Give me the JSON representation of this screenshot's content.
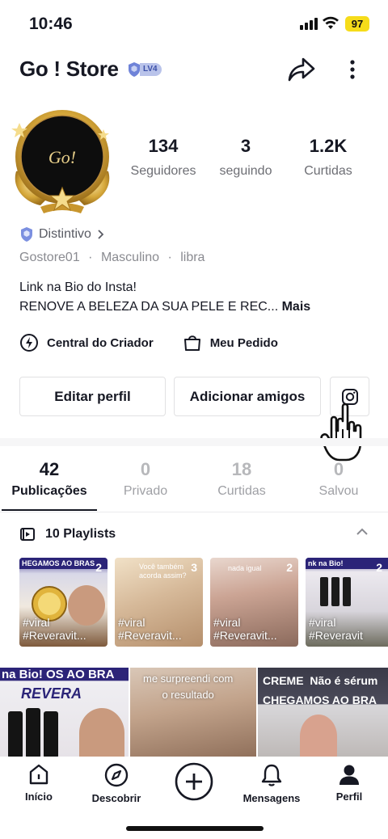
{
  "status_bar": {
    "time": "10:46",
    "battery": "97"
  },
  "header": {
    "title": "Go ! Store",
    "level": "LV4"
  },
  "profile": {
    "avatar_text": "Go!",
    "stats": [
      {
        "value": "134",
        "label": "Seguidores"
      },
      {
        "value": "3",
        "label": "seguindo"
      },
      {
        "value": "1.2K",
        "label": "Curtidas"
      }
    ],
    "badge_label": "Distintivo",
    "username": "Gostore01",
    "gender": "Masculino",
    "zodiac": "libra",
    "bio_line1": "Link na Bio do Insta!",
    "bio_line2": "RENOVE A BELEZA DA SUA PELE E REC...",
    "bio_more": "Mais"
  },
  "quick_links": {
    "creator_center": "Central do Criador",
    "my_order": "Meu Pedido"
  },
  "buttons": {
    "edit_profile": "Editar perfil",
    "add_friends": "Adicionar amigos"
  },
  "tabs": [
    {
      "count": "42",
      "label": "Publicações",
      "active": true
    },
    {
      "count": "0",
      "label": "Privado"
    },
    {
      "count": "18",
      "label": "Curtidas"
    },
    {
      "count": "0",
      "label": "Salvou"
    }
  ],
  "playlists": {
    "title": "10 Playlists",
    "items": [
      {
        "count": "2",
        "top_text": "HEGAMOS AO BRAS",
        "caption": "#viral\n#Reveravit..."
      },
      {
        "count": "3",
        "top_text": "Você também acorda assim?",
        "caption": "#viral\n#Reveravit..."
      },
      {
        "count": "2",
        "top_text": "nada igual",
        "caption": "#viral\n#Reveravit..."
      },
      {
        "count": "2",
        "top_text": "nk na Bio!",
        "caption": "#viral\n#Reveravit"
      }
    ]
  },
  "grid": [
    {
      "top_text": "na Bio!  OS AO BRA",
      "brand": "REVERA"
    },
    {
      "top_text": "me surpreendi com\no resultado"
    },
    {
      "top_text": "CREME  Não é sérum\nCHEGAMOS AO BRA"
    }
  ],
  "nav": [
    {
      "label": "Início"
    },
    {
      "label": "Descobrir"
    },
    {
      "label": ""
    },
    {
      "label": "Mensagens"
    },
    {
      "label": "Perfil"
    }
  ],
  "colors": {
    "accent_blue": "#4a63c9",
    "battery": "#f6dc1a",
    "text": "#161823",
    "muted": "#8a8b91"
  }
}
